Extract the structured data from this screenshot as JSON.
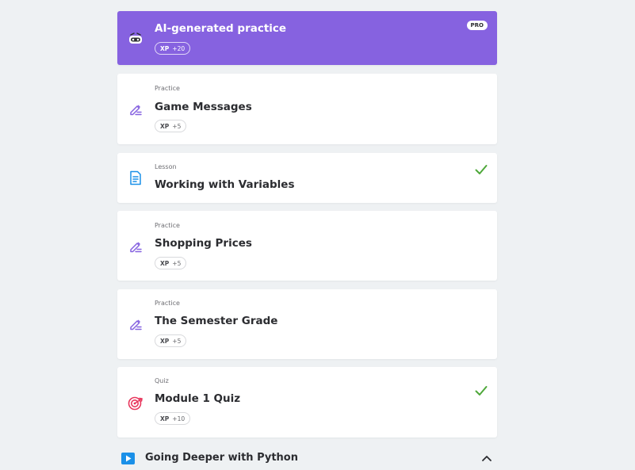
{
  "items": [
    {
      "title": "AI-generated practice",
      "xp_label": "XP",
      "xp_value": "+20",
      "badge": "PRO",
      "icon": "robot-icon"
    },
    {
      "kind": "Practice",
      "title": "Game Messages",
      "xp_label": "XP",
      "xp_value": "+5",
      "icon": "pencil-icon"
    },
    {
      "kind": "Lesson",
      "title": "Working with Variables",
      "completed": true,
      "icon": "document-icon"
    },
    {
      "kind": "Practice",
      "title": "Shopping Prices",
      "xp_label": "XP",
      "xp_value": "+5",
      "icon": "pencil-icon"
    },
    {
      "kind": "Practice",
      "title": "The Semester Grade",
      "xp_label": "XP",
      "xp_value": "+5",
      "icon": "pencil-icon"
    },
    {
      "kind": "Quiz",
      "title": "Module 1 Quiz",
      "xp_label": "XP",
      "xp_value": "+10",
      "completed": true,
      "icon": "target-icon"
    }
  ],
  "next_section": {
    "title": "Going Deeper with Python",
    "icon": "play-icon",
    "expanded": true
  },
  "colors": {
    "ai_purple": "#8662e0",
    "check_green": "#4ea83a",
    "pencil_purple": "#8662e0",
    "doc_blue": "#1a90e8",
    "quiz_red": "#e8375d"
  }
}
